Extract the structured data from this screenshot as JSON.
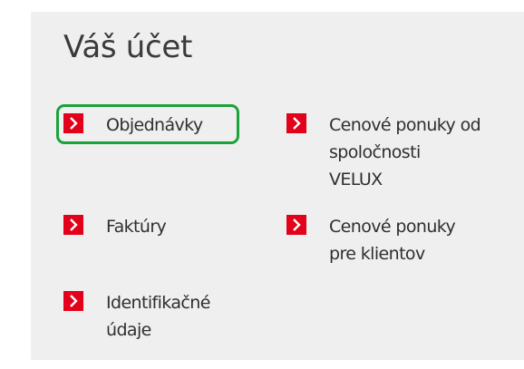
{
  "account": {
    "title": "Váš účet",
    "links": [
      {
        "id": "orders",
        "label_lines": [
          "Objednávky"
        ]
      },
      {
        "id": "quotes-velux",
        "label_lines": [
          "Cenové ponuky od",
          "spoločnosti",
          "VELUX"
        ]
      },
      {
        "id": "invoices",
        "label_lines": [
          "Faktúry"
        ]
      },
      {
        "id": "quotes-clients",
        "label_lines": [
          "Cenové ponuky",
          "pre klientov"
        ]
      },
      {
        "id": "identification",
        "label_lines": [
          "Identifikačné",
          "údaje"
        ]
      }
    ]
  },
  "colors": {
    "panel_bg": "#efefef",
    "arrow_red": "#e2001a",
    "highlight_green": "#1aa33a",
    "text": "#2f2f2f"
  },
  "icons": {
    "link_arrow": "chevron-right-icon"
  }
}
